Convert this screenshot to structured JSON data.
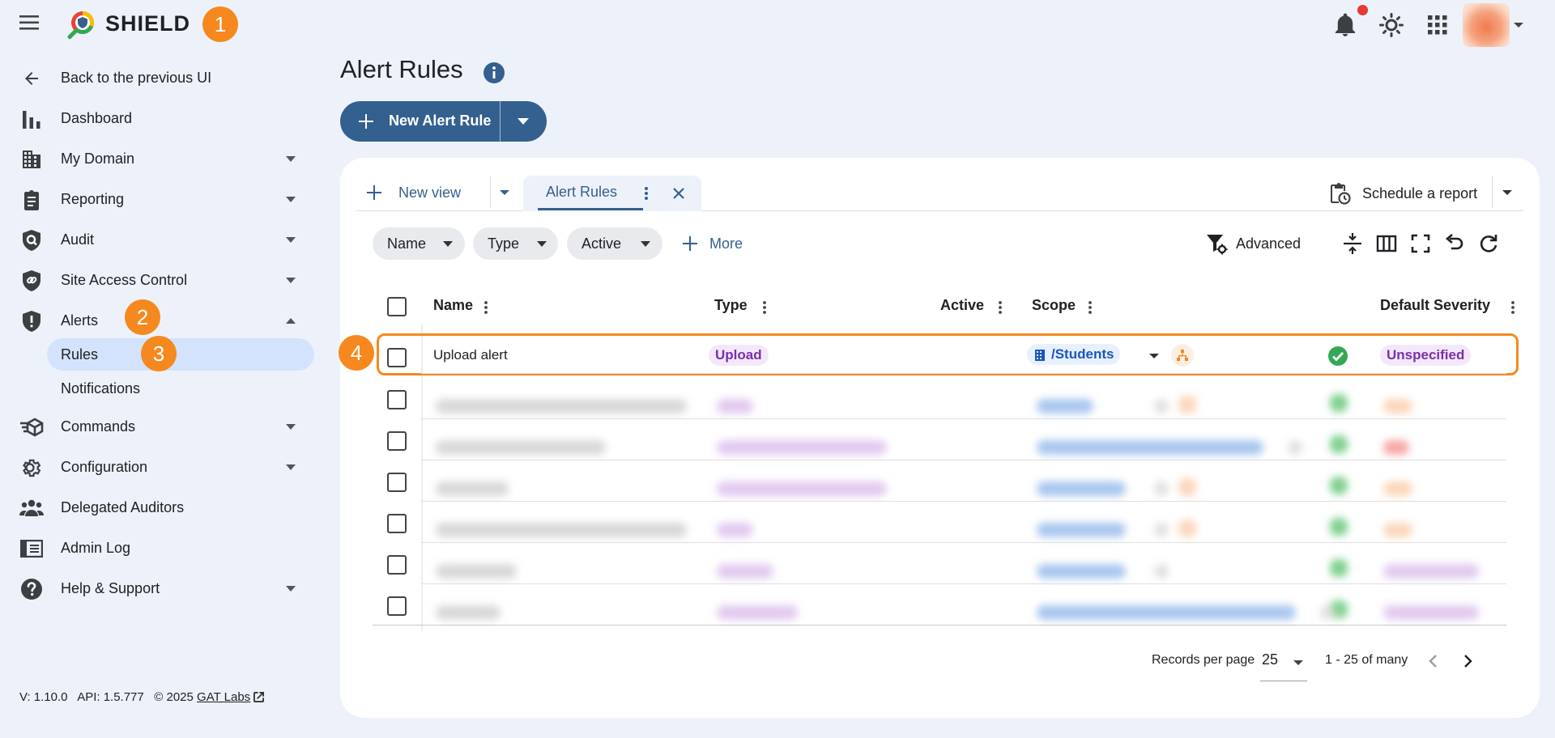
{
  "header": {
    "brand": "SHIELD",
    "step_marker": "1"
  },
  "sidebar": {
    "back": "Back to the previous UI",
    "items": [
      {
        "label": "Dashboard"
      },
      {
        "label": "My Domain"
      },
      {
        "label": "Reporting"
      },
      {
        "label": "Audit"
      },
      {
        "label": "Site Access Control"
      },
      {
        "label": "Alerts"
      },
      {
        "label": "Commands"
      },
      {
        "label": "Configuration"
      },
      {
        "label": "Delegated Auditors"
      },
      {
        "label": "Admin Log"
      },
      {
        "label": "Help & Support"
      }
    ],
    "subitems": [
      {
        "label": "Rules"
      },
      {
        "label": "Notifications"
      }
    ],
    "step_markers": [
      "2",
      "3"
    ]
  },
  "footer": {
    "version": "V: 1.10.0",
    "api": "API: 1.5.777",
    "copyright": "© 2025",
    "company_link": "GAT Labs"
  },
  "main": {
    "title": "Alert Rules",
    "new_button": "New Alert Rule"
  },
  "tabs": {
    "new_view": "New view",
    "active_tab": "Alert Rules",
    "schedule": "Schedule a report"
  },
  "filters": {
    "chips": [
      "Name",
      "Type",
      "Active"
    ],
    "more": "More",
    "advanced": "Advanced"
  },
  "table": {
    "columns": [
      "Name",
      "Type",
      "Active",
      "Scope",
      "Default Severity"
    ],
    "highlighted_row": {
      "name": "Upload alert",
      "type": "Upload",
      "scope": "/Students",
      "severity": "Unspecified"
    },
    "step_marker": "4"
  },
  "pagination": {
    "records_per_page_label": "Records per page",
    "records_per_page_value": "25",
    "range": "1 - 25 of many"
  },
  "colors": {
    "accent": "#34608f",
    "marker": "#f5891f",
    "purple_text": "#7b2fa8",
    "scope_text": "#1a56b8",
    "success": "#34a853"
  }
}
